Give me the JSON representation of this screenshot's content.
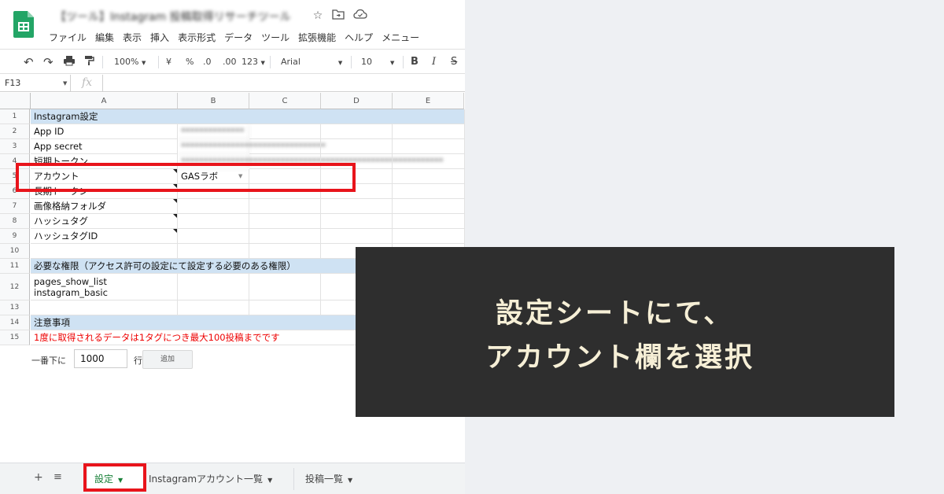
{
  "app": {
    "title_blurred": "【ツール】Instagram 投稿取得リサーチツール",
    "menu": [
      "ファイル",
      "編集",
      "表示",
      "挿入",
      "表示形式",
      "データ",
      "ツール",
      "拡張機能",
      "ヘルプ",
      "メニュー"
    ],
    "toolbar": {
      "zoom": "100%",
      "currency": "¥",
      "percent": "%",
      "dec_less": ".0",
      "dec_more": ".00",
      "format_123": "123",
      "font": "Arial",
      "font_size": "10",
      "bold": "B",
      "italic": "I",
      "strike": "S"
    },
    "namebox": "F13",
    "fx": "fx"
  },
  "grid": {
    "columns": [
      "A",
      "B",
      "C",
      "D",
      "E"
    ],
    "rows": [
      {
        "n": "1",
        "a": "Instagram設定",
        "b": "",
        "section": true
      },
      {
        "n": "2",
        "a": "App ID",
        "b": "**************"
      },
      {
        "n": "3",
        "a": "App secret",
        "b": "********************************"
      },
      {
        "n": "4",
        "a": "短期トークン",
        "b": "**********************************************************"
      },
      {
        "n": "5",
        "a": "アカウント",
        "b": "GASラボ"
      },
      {
        "n": "6",
        "a": "長期トークン",
        "b": ""
      },
      {
        "n": "7",
        "a": "画像格納フォルダ",
        "b": ""
      },
      {
        "n": "8",
        "a": "ハッシュタグ",
        "b": ""
      },
      {
        "n": "9",
        "a": "ハッシュタグID",
        "b": ""
      },
      {
        "n": "10",
        "a": "",
        "b": ""
      },
      {
        "n": "11",
        "a": "必要な権限（アクセス許可の設定にて設定する必要のある権限）",
        "b": "",
        "section": true
      },
      {
        "n": "12",
        "a": "pages_show_list",
        "a2": "instagram_basic",
        "b": ""
      },
      {
        "n": "13",
        "a": "",
        "b": ""
      },
      {
        "n": "14",
        "a": "注意事項",
        "b": "",
        "section": true
      },
      {
        "n": "15",
        "a": "1度に取得されるデータは1タグにつき最大100投稿までです",
        "b": ""
      }
    ]
  },
  "addrow": {
    "label": "一番下に",
    "value": "1000",
    "unit": "行",
    "button": "追加"
  },
  "sheet_tabs": {
    "add": "+",
    "list": "≡",
    "tabs": [
      {
        "label": "設定",
        "active": true
      },
      {
        "label": "Instagramアカウント一覧",
        "active": false
      },
      {
        "label": "投稿一覧",
        "active": false
      }
    ]
  },
  "caption": {
    "line1": "設定シートにて、",
    "line2": "アカウント欄を選択"
  },
  "colors": {
    "highlight": "#e8141b",
    "caption_bg": "#2e2e2e",
    "caption_text": "#f6efd6",
    "section_fill": "#cfe2f3",
    "active_tab": "#188038"
  }
}
